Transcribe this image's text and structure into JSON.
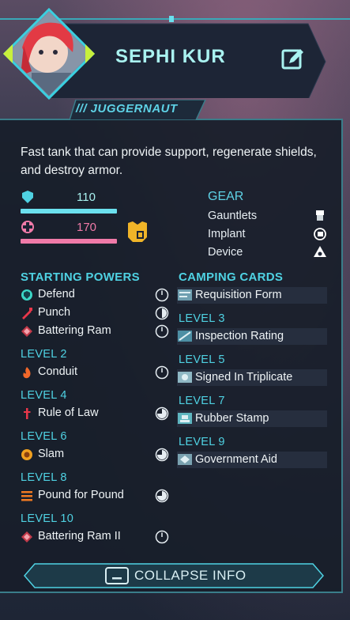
{
  "character": {
    "name": "SEPHI KUR",
    "class": "/// JUGGERNAUT",
    "description": "Fast tank that can provide support, regenerate shields, and destroy armor."
  },
  "stats": {
    "shield": {
      "value": "110",
      "fill": 1.0,
      "color": "#6be0ee",
      "icon": "shield-icon"
    },
    "health": {
      "value": "170",
      "fill": 1.0,
      "color": "#f07aa8",
      "icon": "health-cross-icon"
    }
  },
  "gear": {
    "title": "GEAR",
    "items": [
      {
        "label": "Gauntlets",
        "icon": "gauntlet-icon"
      },
      {
        "label": "Implant",
        "icon": "implant-icon"
      },
      {
        "label": "Device",
        "icon": "device-icon"
      }
    ]
  },
  "powers": {
    "title": "STARTING POWERS",
    "starting": [
      {
        "label": "Defend",
        "icon": "defend-icon",
        "cooldown": 0
      },
      {
        "label": "Punch",
        "icon": "punch-icon",
        "cooldown": 0.5
      },
      {
        "label": "Battering Ram",
        "icon": "battering-ram-icon",
        "cooldown": 0
      }
    ],
    "levels": [
      {
        "level": "LEVEL 2",
        "label": "Conduit",
        "icon": "conduit-icon",
        "cooldown": 0
      },
      {
        "level": "LEVEL 4",
        "label": "Rule of Law",
        "icon": "rule-of-law-icon",
        "cooldown": 0.75
      },
      {
        "level": "LEVEL 6",
        "label": "Slam",
        "icon": "slam-icon",
        "cooldown": 0.75
      },
      {
        "level": "LEVEL 8",
        "label": "Pound for Pound",
        "icon": "pound-icon",
        "cooldown": 0.75
      },
      {
        "level": "LEVEL 10",
        "label": "Battering Ram II",
        "icon": "battering-ram-icon",
        "cooldown": 0
      }
    ]
  },
  "cards": {
    "title": "CAMPING CARDS",
    "starting": {
      "label": "Requisition Form",
      "icon": "requisition-form-icon"
    },
    "levels": [
      {
        "level": "LEVEL 3",
        "label": "Inspection Rating",
        "icon": "inspection-rating-icon"
      },
      {
        "level": "LEVEL 5",
        "label": "Signed In Triplicate",
        "icon": "signed-triplicate-icon"
      },
      {
        "level": "LEVEL 7",
        "label": "Rubber Stamp",
        "icon": "rubber-stamp-icon"
      },
      {
        "level": "LEVEL 9",
        "label": "Government Aid",
        "icon": "government-aid-icon"
      }
    ]
  },
  "footer": {
    "collapse_label": "COLLAPSE INFO",
    "collapse_icon": "collapse-tray-icon"
  },
  "colors": {
    "accent": "#4fd2e3",
    "health": "#f07aa8",
    "shield": "#6be0ee",
    "arrow": "#c8f03c",
    "gear_badge": "#f0b428"
  }
}
